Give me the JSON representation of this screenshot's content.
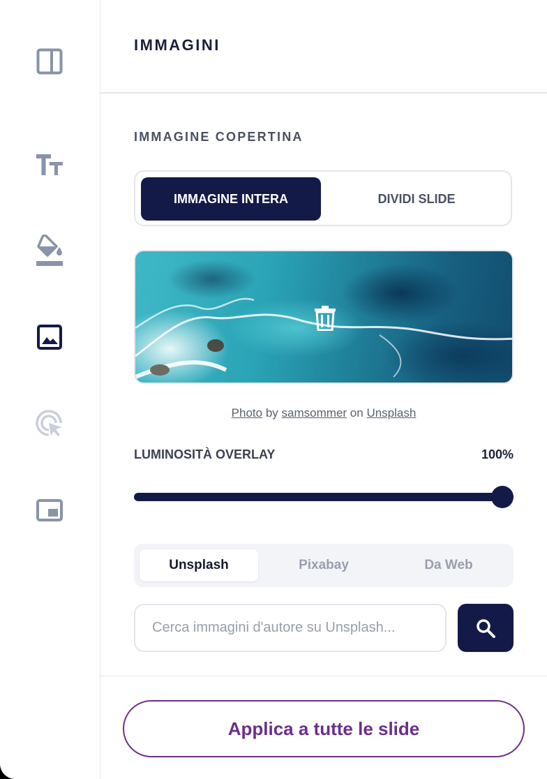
{
  "colors": {
    "primary": "#141a48",
    "accent_purple": "#6b2f8a",
    "icon_gray": "#8a93a8",
    "icon_light": "#c9ced9"
  },
  "sidebar": {
    "items": [
      {
        "icon": "layout-panel-icon",
        "active": false
      },
      {
        "icon": "text-size-icon",
        "active": false
      },
      {
        "icon": "paint-bucket-icon",
        "active": false
      },
      {
        "icon": "image-icon",
        "active": true
      },
      {
        "icon": "click-target-icon",
        "active": false,
        "disabled": true
      },
      {
        "icon": "picture-in-picture-icon",
        "active": false
      }
    ]
  },
  "panel": {
    "title": "IMMAGINI",
    "section_title": "IMMAGINE COPERTINA",
    "layout_options": {
      "full": "IMMAGINE INTERA",
      "split": "DIVIDI SLIDE",
      "selected": "full"
    },
    "cover_image": {
      "alt": "ocean aerial",
      "delete_icon": "trash-icon"
    },
    "credit": {
      "photo": "Photo",
      "by": "by",
      "author": "samsommer",
      "on": "on",
      "source": "Unsplash"
    },
    "overlay": {
      "label": "LUMINOSITÀ OVERLAY",
      "value_text": "100%",
      "value": 1.0
    },
    "sources": {
      "tabs": [
        "Unsplash",
        "Pixabay",
        "Da Web"
      ],
      "selected": "Unsplash"
    },
    "search": {
      "placeholder": "Cerca immagini d'autore su Unsplash...",
      "value": "",
      "button_icon": "search-icon"
    }
  },
  "footer": {
    "apply_label": "Applica a tutte le slide"
  }
}
